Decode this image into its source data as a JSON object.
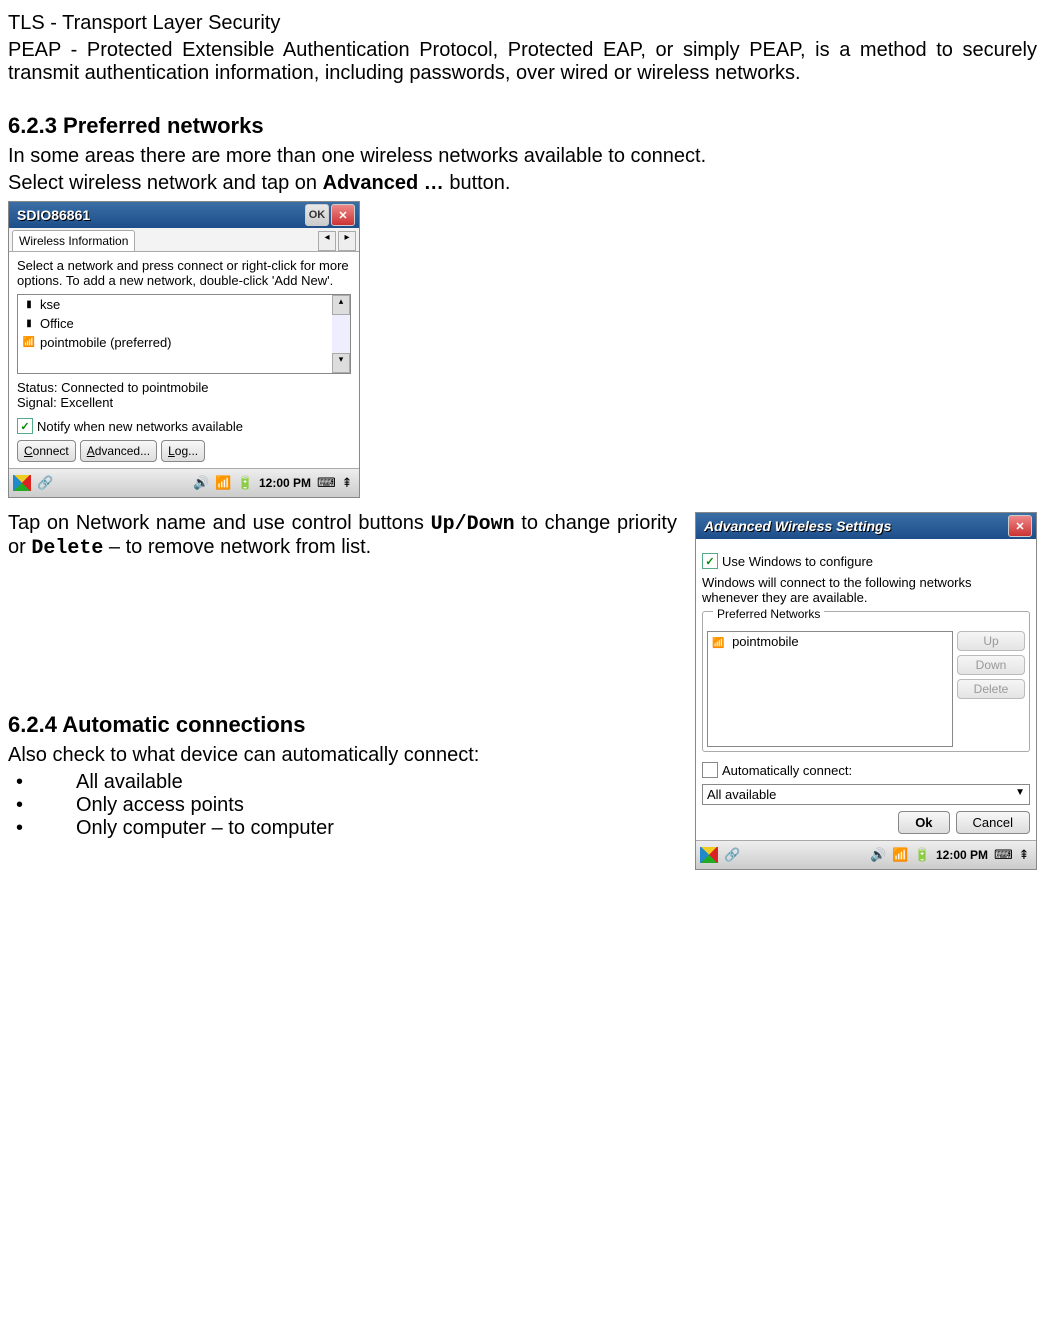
{
  "intro": {
    "tls": "TLS - Transport Layer Security",
    "peap": "PEAP - Protected Extensible Authentication Protocol, Protected EAP, or simply PEAP, is a method to securely transmit authentication information, including passwords, over wired or wireless networks."
  },
  "s623": {
    "heading": "6.2.3 Preferred networks",
    "line1": "In some areas there are more than one wireless networks available to connect.",
    "line2a": "Select wireless network and tap on ",
    "adv_bold": "Advanced  …",
    "line2b": " button."
  },
  "shot1": {
    "title": "SDIO86861",
    "ok": "OK",
    "tab": "Wireless Information",
    "instr": "Select a network and press connect or right-click for more options.  To add a new network, double-click 'Add New'.",
    "net1": "kse",
    "net2": "Office",
    "net3": "pointmobile (preferred)",
    "status": "Status:  Connected to pointmobile",
    "signal": "Signal:  Excellent",
    "notify": "Notify when new networks available",
    "connect": "Connect",
    "advanced": "Advanced...",
    "log": "Log...",
    "time": "12:00 PM"
  },
  "between": {
    "line_a": "Tap on Network name and use control buttons ",
    "updown": "Up/Down",
    "line_b": " to change priority or ",
    "delete": "Delete",
    "line_c": " – to remove network from list."
  },
  "s624": {
    "heading": "6.2.4 Automatic connections",
    "line": "Also check to what device can automatically connect:",
    "b1": "All available",
    "b2": "Only access points",
    "b3": "Only computer – to computer"
  },
  "shot2": {
    "title": "Advanced Wireless Settings",
    "usewin": "Use Windows to configure",
    "desc": "Windows will connect to the following networks whenever they are available.",
    "groupTitle": "Preferred Networks",
    "net": "pointmobile",
    "up": "Up",
    "down": "Down",
    "delete": "Delete",
    "auto": "Automatically connect:",
    "sel": "All available",
    "ok": "Ok",
    "cancel": "Cancel",
    "time": "12:00 PM"
  }
}
